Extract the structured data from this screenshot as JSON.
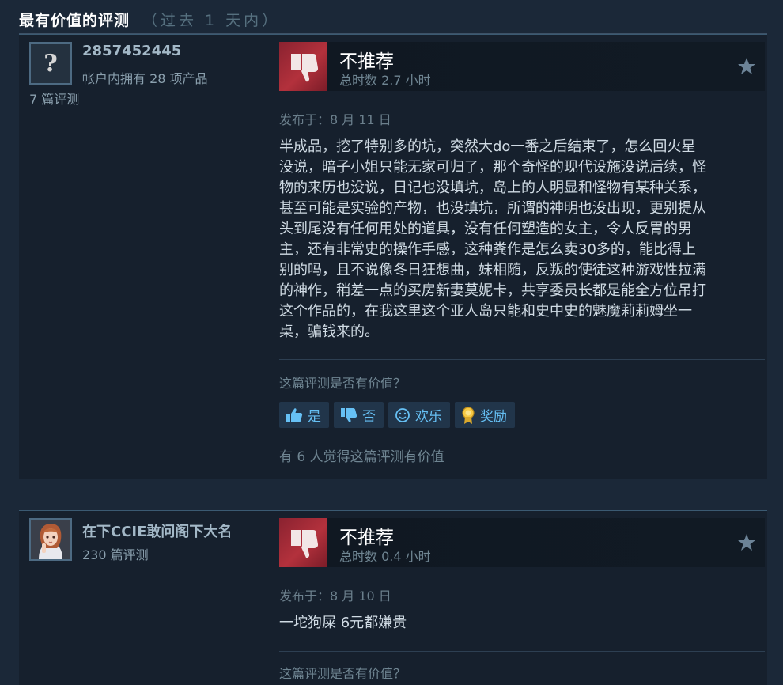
{
  "header": {
    "title": "最有价值的评测",
    "subtitle": "（过去 1 天内）"
  },
  "reviews": [
    {
      "author": {
        "name": "2857452445",
        "products": "帐户内拥有 28 项产品",
        "review_count": "7 篇评测",
        "avatar": "question-mark-avatar"
      },
      "verdict": "不推荐",
      "playtime": "总时数 2.7 小时",
      "posted": "发布于：8 月 11 日",
      "body_lines": [
        "半成品，挖了特别多的坑，突然大do一番之后结束了，怎么回火星",
        "没说，暗子小姐只能无家可归了，那个奇怪的现代设施没说后续，怪",
        "物的来历也没说，日记也没填坑，岛上的人明显和怪物有某种关系，",
        "甚至可能是实验的产物，也没填坑，所谓的神明也没出现，更别提从",
        "头到尾没有任何用处的道具，没有任何塑造的女主，令人反胃的男",
        "主，还有非常史的操作手感，这种粪作是怎么卖30多的，能比得上",
        "别的吗，且不说像冬日狂想曲，妹相随，反叛的使徒这种游戏性拉满",
        "的神作，稍差一点的买房新妻莫妮卡，共享委员长都是能全方位吊打",
        "这个作品的，在我这里这个亚人岛只能和史中史的魅魔莉莉姆坐一",
        "桌，骗钱来的。"
      ],
      "helpful_question": "这篇评测是否有价值？",
      "buttons": {
        "yes": "是",
        "no": "否",
        "funny": "欢乐",
        "award": "奖励"
      },
      "helpful_count": "有 6 人觉得这篇评测有价值"
    },
    {
      "author": {
        "name": "在下CCIE敢问阁下大名",
        "review_count": "230 篇评测",
        "avatar": "anime-girl-avatar"
      },
      "verdict": "不推荐",
      "playtime": "总时数 0.4 小时",
      "posted": "发布于：8 月 10 日",
      "body_lines": [
        "一坨狗屎 6元都嫌贵"
      ],
      "helpful_question": "这篇评测是否有价值？"
    }
  ],
  "colors": {
    "thumb_down_bg": "#a32b36",
    "link_blue": "#66c0f4",
    "page_bg": "#1b2838"
  }
}
